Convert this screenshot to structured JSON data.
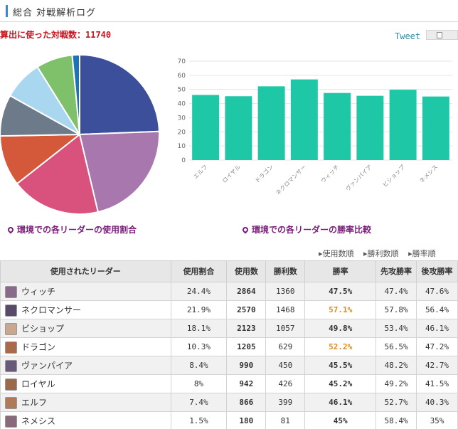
{
  "header": {
    "title": "総合 対戦解析ログ"
  },
  "summary": {
    "battle_count_text": "算出に使った対戦数：11740"
  },
  "share": {
    "tweet_label": "Tweet",
    "share_icon": "share-icon"
  },
  "captions": {
    "pie": "環境での各リーダーの使用割合",
    "bar": "環境での各リーダーの勝率比較"
  },
  "sort_links": [
    "▸使用数順",
    "▸勝利数順",
    "▸勝率順"
  ],
  "table": {
    "headers": [
      "使用されたリーダー",
      "使用割合",
      "使用数",
      "勝利数",
      "勝率",
      "先攻勝率",
      "後攻勝率"
    ],
    "rows": [
      {
        "leader": "ウィッチ",
        "share": "24.4%",
        "uses": "2864",
        "wins": "1360",
        "rate": "47.5%",
        "first": "47.4%",
        "second": "47.6%",
        "color": "#8a6a8a"
      },
      {
        "leader": "ネクロマンサー",
        "share": "21.9%",
        "uses": "2570",
        "wins": "1468",
        "rate": "57.1%",
        "first": "57.8%",
        "second": "56.4%",
        "color": "#5a4a6a"
      },
      {
        "leader": "ビショップ",
        "share": "18.1%",
        "uses": "2123",
        "wins": "1057",
        "rate": "49.8%",
        "first": "53.4%",
        "second": "46.1%",
        "color": "#c8a890"
      },
      {
        "leader": "ドラゴン",
        "share": "10.3%",
        "uses": "1205",
        "wins": "629",
        "rate": "52.2%",
        "first": "56.5%",
        "second": "47.2%",
        "color": "#a86a4a"
      },
      {
        "leader": "ヴァンパイア",
        "share": "8.4%",
        "uses": "990",
        "wins": "450",
        "rate": "45.5%",
        "first": "48.2%",
        "second": "42.7%",
        "color": "#6a5a7a"
      },
      {
        "leader": "ロイヤル",
        "share": "8%",
        "uses": "942",
        "wins": "426",
        "rate": "45.2%",
        "first": "49.2%",
        "second": "41.5%",
        "color": "#9a6a4a"
      },
      {
        "leader": "エルフ",
        "share": "7.4%",
        "uses": "866",
        "wins": "399",
        "rate": "46.1%",
        "first": "52.7%",
        "second": "40.3%",
        "color": "#b07a5a"
      },
      {
        "leader": "ネメシス",
        "share": "1.5%",
        "uses": "180",
        "wins": "81",
        "rate": "45%",
        "first": "58.4%",
        "second": "35%",
        "color": "#8a6a7a"
      }
    ]
  },
  "chart_data": [
    {
      "type": "pie",
      "title": "",
      "categories": [
        "ウィッチ",
        "ネクロマンサー",
        "ビショップ",
        "ドラゴン",
        "ヴァンパイア",
        "ロイヤル",
        "エルフ",
        "ネメシス"
      ],
      "values": [
        24.4,
        21.9,
        18.1,
        10.3,
        8.4,
        8.0,
        7.4,
        1.5
      ],
      "colors": [
        "#3b4f9b",
        "#a877ad",
        "#d9517d",
        "#d3593a",
        "#6d7a89",
        "#a9d7f0",
        "#7fc06b",
        "#1e72b8"
      ]
    },
    {
      "type": "bar",
      "title": "",
      "categories": [
        "エルフ",
        "ロイヤル",
        "ドラゴン",
        "ネクロマンサー",
        "ウィッチ",
        "ヴァンパイア",
        "ビショップ",
        "ネメシス"
      ],
      "values": [
        46.1,
        45.2,
        52.2,
        57.1,
        47.5,
        45.5,
        49.8,
        45.0
      ],
      "ylim": [
        0,
        70
      ],
      "yticks": [
        0,
        10,
        20,
        30,
        40,
        50,
        60,
        70
      ],
      "color": "#1ec8a6",
      "grid": true
    }
  ]
}
